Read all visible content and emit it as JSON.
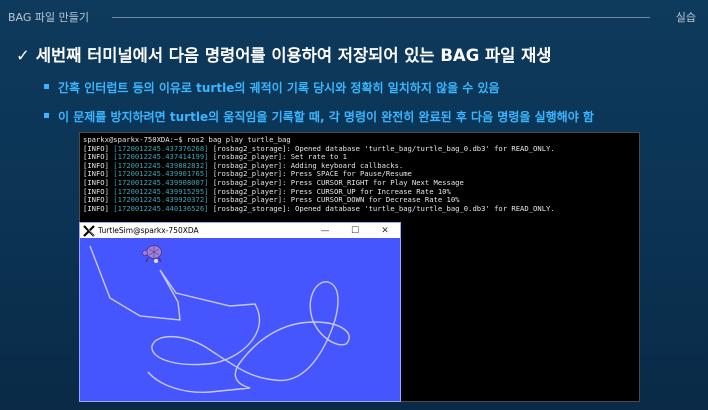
{
  "header": {
    "title": "BAG 파일 만들기",
    "right": "실습"
  },
  "heading": {
    "check": "✓",
    "text": "세번째 터미널에서 다음 명령어를 이용하여 저장되어 있는 BAG 파일 재생"
  },
  "bullets": [
    "간혹 인터럽트 등의 이유로 turtle의 궤적이 기록 당시와 정확히 일치하지 않을 수 있음",
    "이 문제를 방지하려면 turtle의 움직임을 기록할 때, 각 명령이 완전히 완료된 후 다음 명령을 실행해야 함"
  ],
  "terminal": {
    "prompt": "sparkx@sparkx-750XDA:~$ ros2 bag play turtle_bag",
    "lines": [
      {
        "level": "[INFO]",
        "ts": "[1720012245.437376268]",
        "msg": "[rosbag2_storage]: Opened database 'turtle_bag/turtle_bag_0.db3' for READ_ONLY."
      },
      {
        "level": "[INFO]",
        "ts": "[1720012245.437414199]",
        "msg": "[rosbag2_player]: Set rate to 1"
      },
      {
        "level": "[INFO]",
        "ts": "[1720012245.439882832]",
        "msg": "[rosbag2_player]: Adding keyboard callbacks."
      },
      {
        "level": "[INFO]",
        "ts": "[1720012245.439901765]",
        "msg": "[rosbag2_player]: Press SPACE for Pause/Resume"
      },
      {
        "level": "[INFO]",
        "ts": "[1720012245.439908007]",
        "msg": "[rosbag2_player]: Press CURSOR_RIGHT for Play Next Message"
      },
      {
        "level": "[INFO]",
        "ts": "[1720012245.439915295]",
        "msg": "[rosbag2_player]: Press CURSOR_UP for Increase Rate 10%"
      },
      {
        "level": "[INFO]",
        "ts": "[1720012245.439920372]",
        "msg": "[rosbag2_player]: Press CURSOR_DOWN for Decrease Rate 10%"
      },
      {
        "level": "[INFO]",
        "ts": "[1720012245.440136526]",
        "msg": "[rosbag2_storage]: Opened database 'turtle_bag/turtle_bag_0.db3' for READ_ONLY."
      }
    ]
  },
  "turtlesim": {
    "title": "TurtleSim@sparkx-750XDA",
    "minimize": "—",
    "maximize": "☐",
    "close": "✕",
    "background_color": "#4656ff",
    "path_color": "#c8c8e8"
  }
}
